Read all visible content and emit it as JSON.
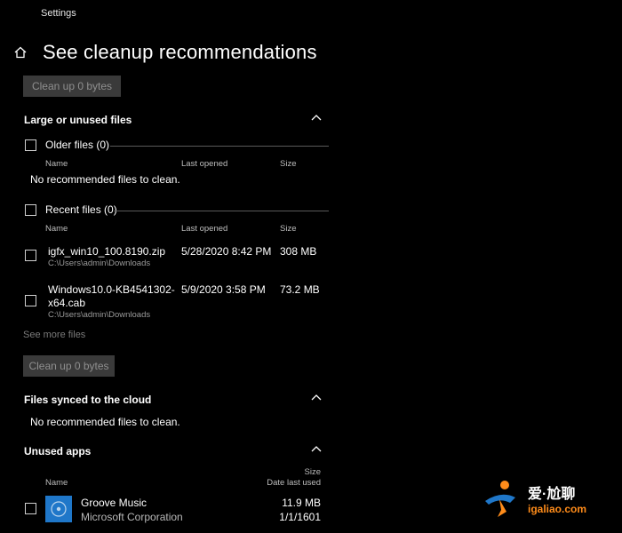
{
  "window": {
    "title": "Settings"
  },
  "page": {
    "title": "See cleanup recommendations"
  },
  "top_button": {
    "label": "Clean up 0 bytes"
  },
  "large_unused": {
    "title": "Large or unused files",
    "older": {
      "label": "Older files (0)",
      "columns": [
        "Name",
        "Last opened",
        "Size"
      ],
      "empty_message": "No recommended files to clean."
    },
    "recent": {
      "label": "Recent files (0)",
      "columns": [
        "Name",
        "Last opened",
        "Size"
      ],
      "files": [
        {
          "name": "igfx_win10_100.8190.zip",
          "path": "C:\\Users\\admin\\Downloads",
          "last_opened": "5/28/2020 8:42 PM",
          "size": "308 MB"
        },
        {
          "name_line1": "Windows10.0-KB4541302-",
          "name_line2": "x64.cab",
          "path": "C:\\Users\\admin\\Downloads",
          "last_opened": "5/9/2020 3:58 PM",
          "size": "73.2 MB"
        }
      ]
    },
    "see_more": "See more files",
    "button": "Clean up 0 bytes"
  },
  "cloud": {
    "title": "Files synced to the cloud",
    "empty_message": "No recommended files to clean."
  },
  "unused_apps": {
    "title": "Unused apps",
    "columns": {
      "name": "Name",
      "size": "Size",
      "date": "Date last used"
    },
    "apps": [
      {
        "name": "Groove Music",
        "publisher": "Microsoft Corporation",
        "size": "11.9 MB",
        "date": "1/1/1601"
      }
    ]
  },
  "watermark": {
    "text": "爱·尬聊",
    "domain": "igaliao.com"
  },
  "colors": {
    "background": "#000000",
    "button": "#3a3a3a",
    "accent": "#1f77c9",
    "watermark": "#ff8c1a"
  }
}
